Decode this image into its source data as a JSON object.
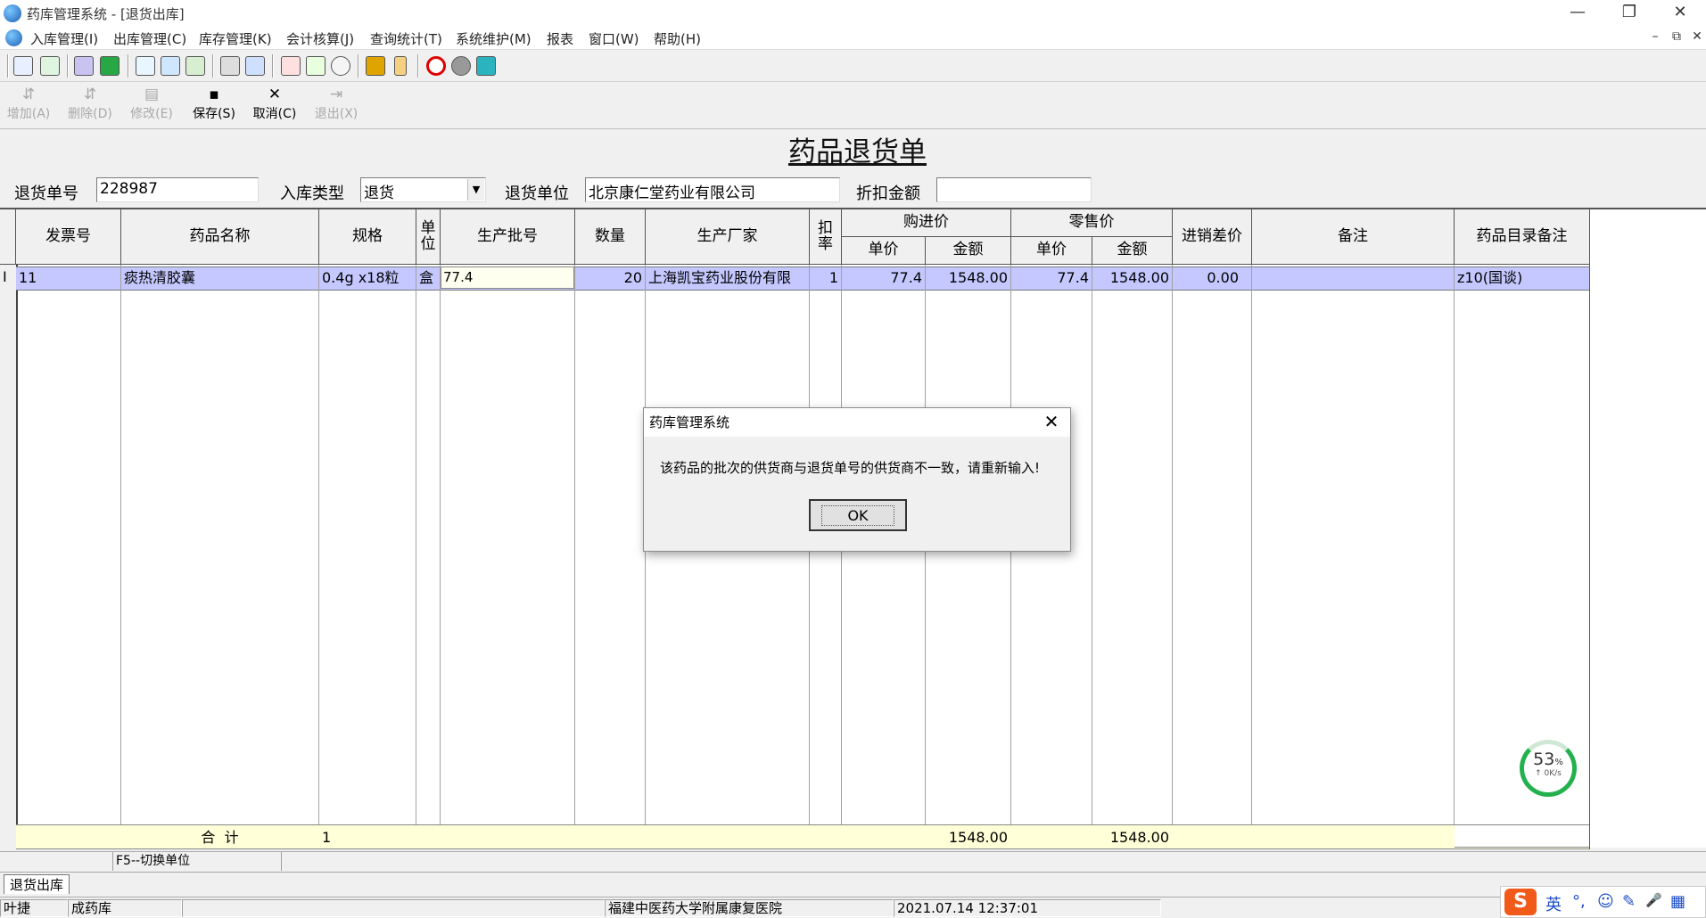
{
  "window": {
    "title": "药库管理系统 - [退货出库]",
    "controls": [
      "—",
      "❐",
      "✕"
    ]
  },
  "menu": {
    "items": [
      "入库管理(I)",
      "出库管理(C)",
      "库存管理(K)",
      "会计核算(J)",
      "查询统计(T)",
      "系统维护(M)",
      "报表",
      "窗口(W)",
      "帮助(H)"
    ],
    "mdi_controls": [
      "–",
      "⧉",
      "✕"
    ]
  },
  "actions": [
    {
      "label": "增加(A)",
      "icon": "⇵",
      "enabled": false
    },
    {
      "label": "删除(D)",
      "icon": "⇵",
      "enabled": false
    },
    {
      "label": "修改(E)",
      "icon": "▤",
      "enabled": false
    },
    {
      "label": "保存(S)",
      "icon": "▪",
      "enabled": true
    },
    {
      "label": "取消(C)",
      "icon": "✕",
      "enabled": true
    },
    {
      "label": "退出(X)",
      "icon": "⇥",
      "enabled": false
    }
  ],
  "form": {
    "title": "药品退货单",
    "return_no_label": "退货单号",
    "return_no": "228987",
    "type_label": "入库类型",
    "type_value": "退货",
    "unit_label": "退货单位",
    "unit_value": "北京康仁堂药业有限公司",
    "discount_label": "折扣金额",
    "discount_value": ""
  },
  "grid": {
    "headers": {
      "invoice": "发票号",
      "name": "药品名称",
      "spec": "规格",
      "unit": "单位",
      "batch": "生产批号",
      "qty": "数量",
      "maker": "生产厂家",
      "rate": "扣率",
      "purchase": "购进价",
      "retail": "零售价",
      "price": "单价",
      "amount": "金额",
      "diff": "进销差价",
      "note": "备注",
      "catalog_note": "药品目录备注"
    },
    "row": {
      "indicator": "I",
      "invoice": "11",
      "name": "痰热清胶囊",
      "spec": "0.4g x18粒",
      "unit": "盒",
      "batch": "77.4",
      "qty": "20",
      "maker": "上海凯宝药业股份有限",
      "rate": "1",
      "purchase_price": "77.4",
      "purchase_amount": "1548.00",
      "retail_price": "77.4",
      "retail_amount": "1548.00",
      "diff": "0.00",
      "note": "",
      "catalog_note": "z10(国谈)"
    },
    "total": {
      "label": "合  计",
      "spec": "1",
      "purchase_amount": "1548.00",
      "retail_amount": "1548.00"
    }
  },
  "hint": "F5--切换单位",
  "tab": "退货出库",
  "status": {
    "user": "叶捷",
    "store": "成药库",
    "hospital": "福建中医药大学附属康复医院",
    "datetime": "2021.07.14 12:37:01"
  },
  "dialog": {
    "title": "药库管理系统",
    "close": "✕",
    "message": "该药品的批次的供货商与退货单号的供货商不一致，请重新输入!",
    "ok": "OK"
  },
  "speed": {
    "percent": "53",
    "unit": "%",
    "rate": "↑ 0K/s"
  },
  "ime": {
    "logo": "S",
    "lang": "英",
    "punct": "°,",
    "emoji": "☺",
    "pen": "✎",
    "mic": "🎤",
    "grid": "▦"
  },
  "colors": {
    "selected_row": "#c4c8ff",
    "total_row": "#ffffd8",
    "speed_ring": "#22b14c",
    "ime_logo": "#f25a1a"
  }
}
